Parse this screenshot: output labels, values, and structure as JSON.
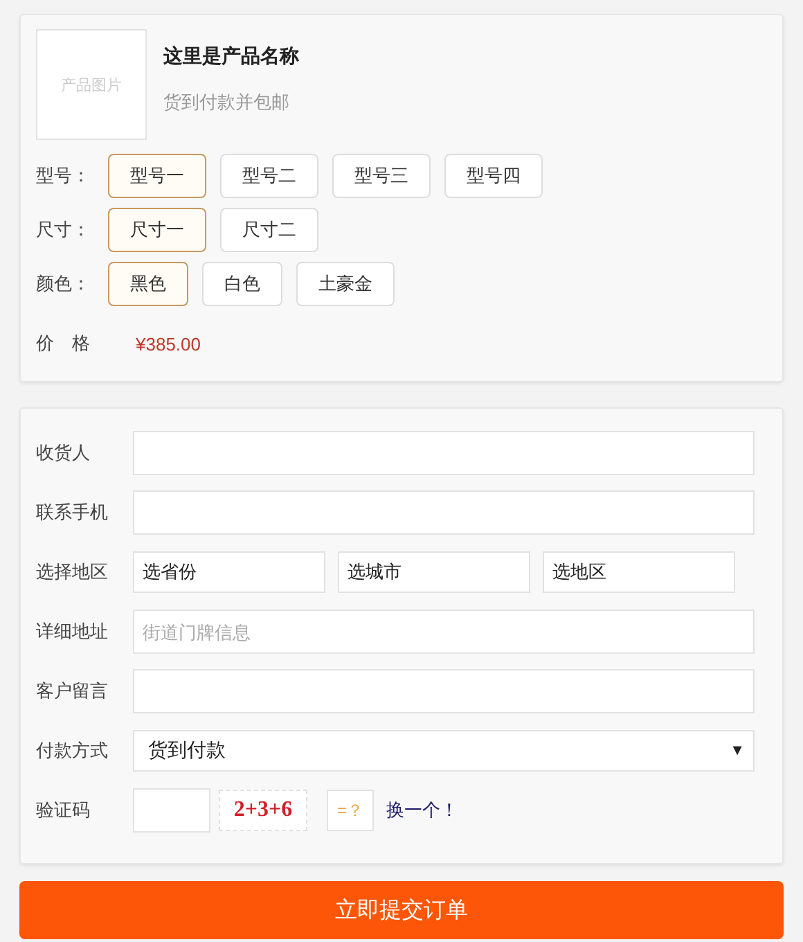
{
  "product": {
    "image_label": "产品图片",
    "name": "这里是产品名称",
    "subtitle": "货到付款并包邮"
  },
  "options": [
    {
      "label": "型号：",
      "choices": [
        {
          "label": "型号一",
          "selected": true
        },
        {
          "label": "型号二",
          "selected": false
        },
        {
          "label": "型号三",
          "selected": false
        },
        {
          "label": "型号四",
          "selected": false
        }
      ]
    },
    {
      "label": "尺寸：",
      "choices": [
        {
          "label": "尺寸一",
          "selected": true
        },
        {
          "label": "尺寸二",
          "selected": false
        }
      ]
    },
    {
      "label": "颜色：",
      "choices": [
        {
          "label": "黑色",
          "selected": true
        },
        {
          "label": "白色",
          "selected": false
        },
        {
          "label": "土豪金",
          "selected": false
        }
      ]
    }
  ],
  "price": {
    "label": "价　格",
    "value": "¥385.00"
  },
  "form": {
    "fields": [
      {
        "kind": "text",
        "label": "收货人"
      },
      {
        "kind": "text",
        "label": "联系手机"
      },
      {
        "kind": "region",
        "label": "选择地区",
        "selects": [
          "选省份",
          "选城市",
          "选地区"
        ]
      },
      {
        "kind": "text",
        "label": "详细地址",
        "placeholder": "街道门牌信息"
      },
      {
        "kind": "text",
        "label": "客户留言"
      },
      {
        "kind": "dropdown",
        "label": "付款方式",
        "value": "货到付款",
        "arrow": "▼"
      },
      {
        "kind": "captcha",
        "label": "验证码",
        "question": "2+3+6",
        "equals": "=？",
        "refresh": "换一个！"
      }
    ]
  },
  "submit": "立即提交订单"
}
